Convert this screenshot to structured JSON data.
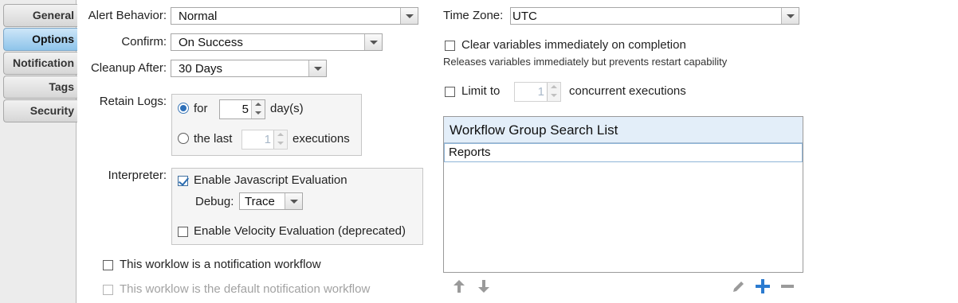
{
  "tabs": [
    {
      "label": "General",
      "active": false
    },
    {
      "label": "Options",
      "active": true
    },
    {
      "label": "Notification",
      "active": false
    },
    {
      "label": "Tags",
      "active": false
    },
    {
      "label": "Security",
      "active": false
    }
  ],
  "alert_behavior": {
    "label": "Alert Behavior:",
    "value": "Normal"
  },
  "confirm": {
    "label": "Confirm:",
    "value": "On Success"
  },
  "cleanup_after": {
    "label": "Cleanup After:",
    "value": "30 Days"
  },
  "retain_logs": {
    "label": "Retain Logs:",
    "option_for": {
      "label": "for",
      "selected": true,
      "value": "5",
      "unit": "day(s)"
    },
    "option_last": {
      "label": "the last",
      "selected": false,
      "value": "1",
      "unit": "executions"
    }
  },
  "interpreter": {
    "label": "Interpreter:",
    "enable_js": {
      "label": "Enable Javascript Evaluation",
      "checked": true
    },
    "debug": {
      "label": "Debug:",
      "value": "Trace"
    },
    "enable_velocity": {
      "label": "Enable Velocity Evaluation (deprecated)",
      "checked": false
    }
  },
  "notification_workflow": {
    "label": "This worklow is a notification workflow",
    "checked": false
  },
  "default_notification_workflow": {
    "label": "This worklow is the default notification workflow",
    "checked": false,
    "enabled": false
  },
  "time_zone": {
    "label": "Time Zone:",
    "value": "UTC"
  },
  "clear_variables": {
    "label": "Clear variables immediately on completion",
    "checked": false,
    "note": "Releases variables immediately but prevents restart capability"
  },
  "limit_to": {
    "label": "Limit to",
    "value": "1",
    "suffix": "concurrent executions",
    "checked": false
  },
  "workflow_group_list": {
    "header": "Workflow Group Search List",
    "items": [
      "Reports"
    ]
  },
  "colors": {
    "accent": "#2d6fb8",
    "active_tab": "#8ec4ea",
    "list_header": "#e3eef9",
    "add_icon": "#2b7bd0"
  }
}
